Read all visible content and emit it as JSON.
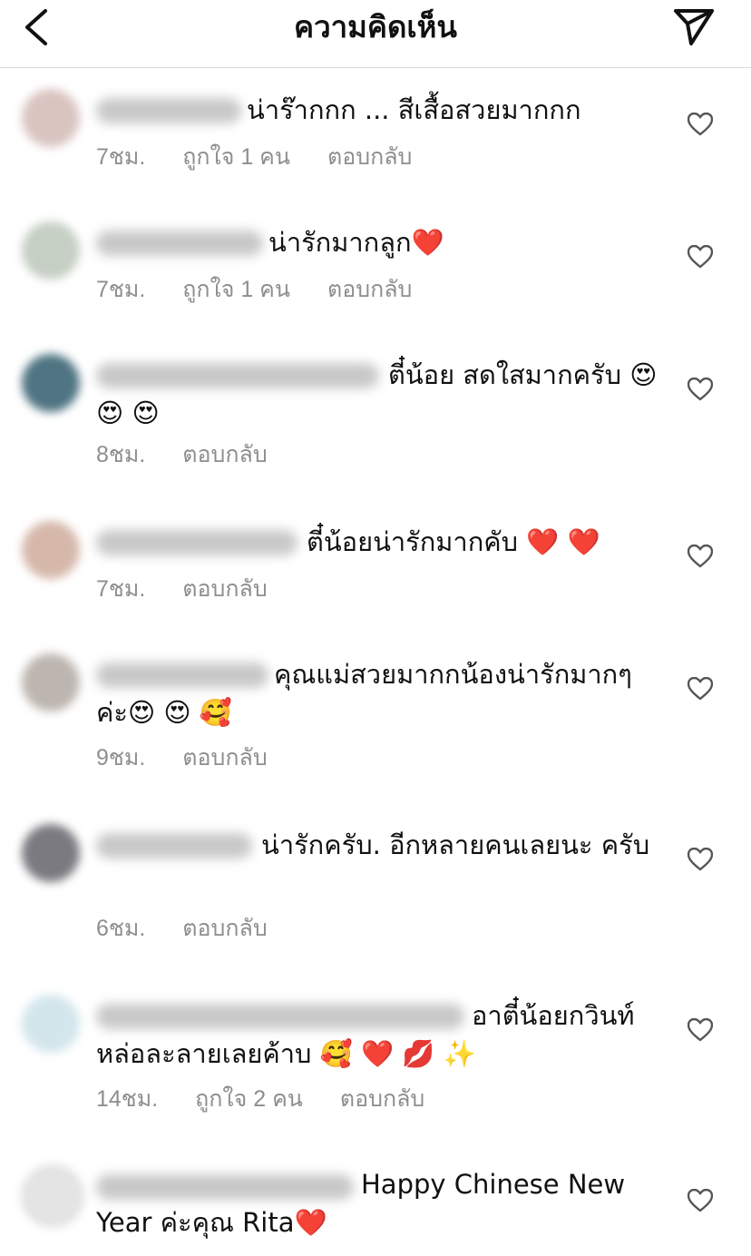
{
  "header": {
    "title": "ความคิดเห็น"
  },
  "comments": [
    {
      "text": "น่าร๊ากกก ... สีเสื้อสวยมากกก",
      "time": "7ชม.",
      "likes": "ถูกใจ 1 คน",
      "reply": "ตอบกลับ"
    },
    {
      "text": "น่ารักมากลูก❤️",
      "time": "7ชม.",
      "likes": "ถูกใจ 1 คน",
      "reply": "ตอบกลับ"
    },
    {
      "text": "ตี๋น้อย สดใสมากครับ 😍 😍 😍",
      "time": "8ชม.",
      "reply": "ตอบกลับ"
    },
    {
      "text": "ตี๋น้อยน่ารักมากคับ ❤️ ❤️",
      "time": "7ชม.",
      "reply": "ตอบกลับ"
    },
    {
      "text": "คุณแม่สวยมากกน้องน่ารักมากๆ ค่ะ😍 😍 🥰",
      "time": "9ชม.",
      "reply": "ตอบกลับ"
    },
    {
      "text": "น่ารักครับ. อีกหลายคนเลยนะ ครับ",
      "time": "6ชม.",
      "reply": "ตอบกลับ"
    },
    {
      "text": "อาตี๋น้อยกวินท์ หล่อละลายเลยค้าบ 🥰 ❤️ 💋 ✨",
      "time": "14ชม.",
      "likes": "ถูกใจ 2 คน",
      "reply": "ตอบกลับ"
    },
    {
      "text": "Happy Chinese New Year ค่ะคุณ Rita❤️"
    }
  ]
}
